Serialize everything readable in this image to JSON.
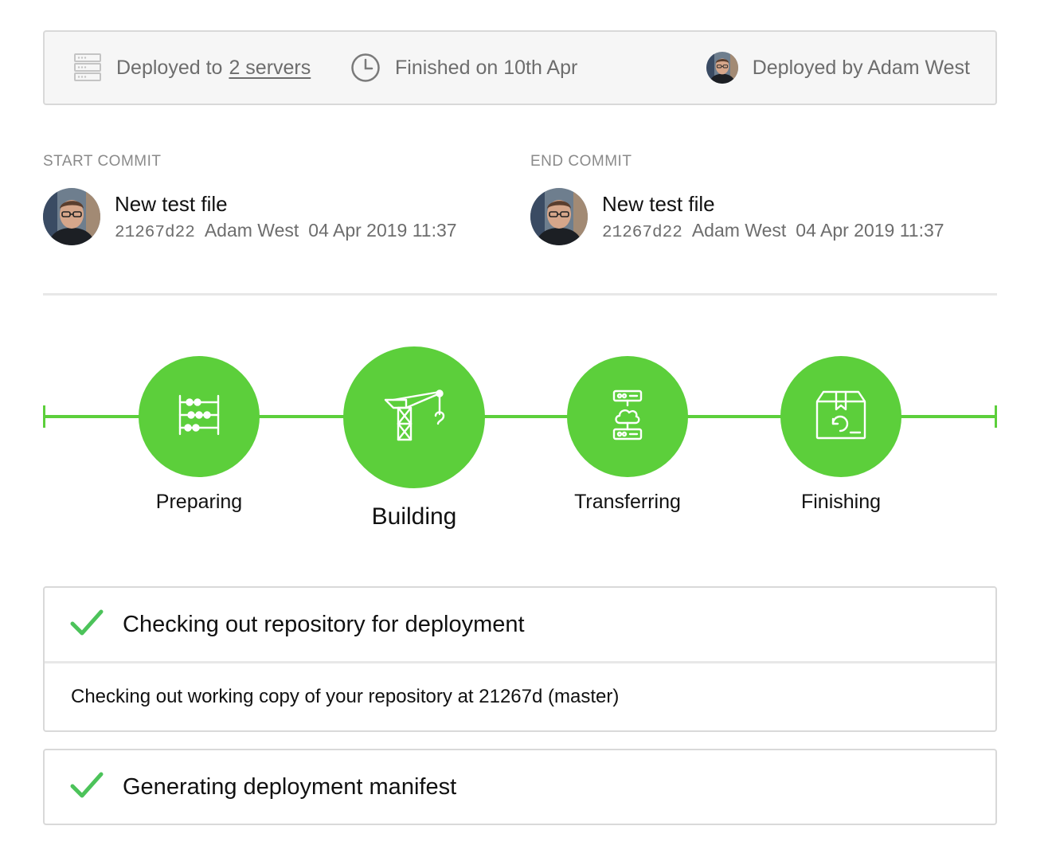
{
  "summary": {
    "deployed_prefix": "Deployed to",
    "servers_link": "2 servers",
    "finished": "Finished on 10th Apr",
    "deployed_by": "Deployed by Adam West"
  },
  "commits": {
    "start": {
      "label": "START COMMIT",
      "message": "New test file",
      "hash": "21267d22",
      "author": "Adam West",
      "date": "04 Apr 2019 11:37"
    },
    "end": {
      "label": "END COMMIT",
      "message": "New test file",
      "hash": "21267d22",
      "author": "Adam West",
      "date": "04 Apr 2019 11:37"
    }
  },
  "pipeline": {
    "accent_color": "#5ccf3b",
    "stages": [
      {
        "label": "Preparing",
        "icon": "abacus-icon",
        "active": false
      },
      {
        "label": "Building",
        "icon": "crane-icon",
        "active": true
      },
      {
        "label": "Transferring",
        "icon": "server-cloud-icon",
        "active": false
      },
      {
        "label": "Finishing",
        "icon": "package-icon",
        "active": false
      }
    ]
  },
  "steps": [
    {
      "title": "Checking out repository for deployment",
      "status": "success",
      "detail": "Checking out working copy of your repository at 21267d (master)"
    },
    {
      "title": "Generating deployment manifest",
      "status": "success"
    }
  ],
  "colors": {
    "success_check": "#4cc35a",
    "border": "#d9d9d9",
    "muted_text": "#6d6d6d"
  }
}
